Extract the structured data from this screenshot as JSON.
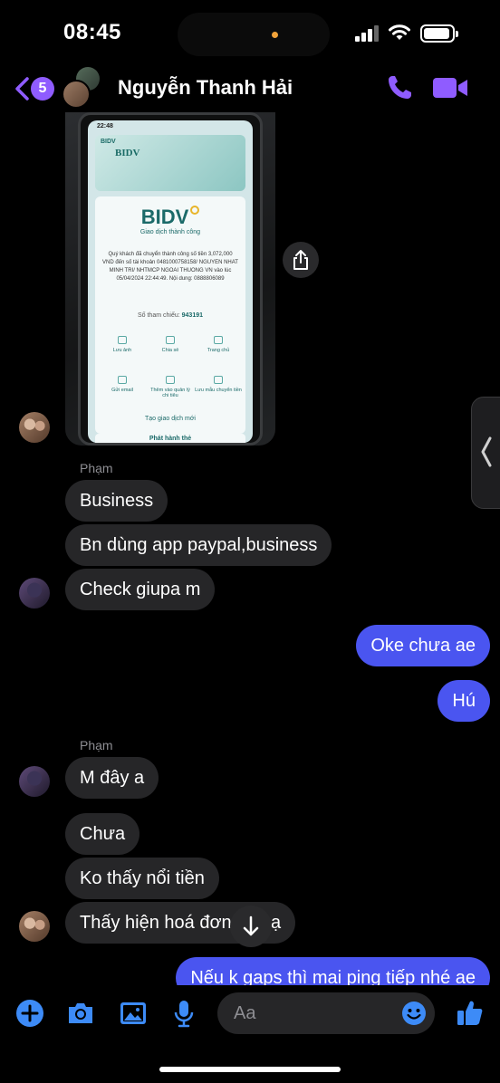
{
  "status_bar": {
    "time": "08:45"
  },
  "header": {
    "back_count": "5",
    "contact_name": "Nguyễn Thanh Hải",
    "call_icon": "phone-icon",
    "video_icon": "video-camera-icon"
  },
  "photo": {
    "screen_time": "22:48",
    "banner_logo": "BIDV",
    "banner_title": "BIDV",
    "logo": "BIDV",
    "subtitle": "Giao dịch thành công",
    "body": "Quý khách đã chuyển thành công số tiền 3,072,000 VND đến số tài khoản 0481000758158/ NGUYEN NHAT MINH TRI/ NHTMCP NGOAI THUONG VN vào lúc 05/04/2024 22:44:49. Nội dung: 0888806089",
    "ref_label": "Số tham chiếu:",
    "ref_value": "943191",
    "actions": [
      "Lưu ảnh",
      "Chia sẻ",
      "Trang chủ",
      "Gửi email",
      "Thêm vào quản lý chi tiêu",
      "Lưu mẫu chuyển tiền"
    ],
    "new_transaction": "Tạo giao dịch mới",
    "issue_card": "Phát hành thẻ"
  },
  "messages": {
    "sender1": "Phạm",
    "m1": "Business",
    "m2": "Bn dùng app paypal,business",
    "m3": "Check giupa m",
    "m4": "Oke chưa ae",
    "m5": "Hú",
    "sender2": "Phạm",
    "m6": "M đây a",
    "m7": "Chưa",
    "m8": "Ko thấy nổi tiền",
    "m9": "Thấy hiện hoá đơn sếp ạ",
    "m10": "Nếu k gaps thì mai ping tiếp nhé ae"
  },
  "composer": {
    "placeholder": "Aa",
    "icons": [
      "plus-icon",
      "camera-icon",
      "image-icon",
      "microphone-icon",
      "emoji-icon",
      "thumbs-up-icon"
    ]
  },
  "colors": {
    "accent": "#8f5cff",
    "outgoing": "#4a55f0",
    "incoming": "#262628",
    "composer_blue": "#3d8bf7"
  }
}
